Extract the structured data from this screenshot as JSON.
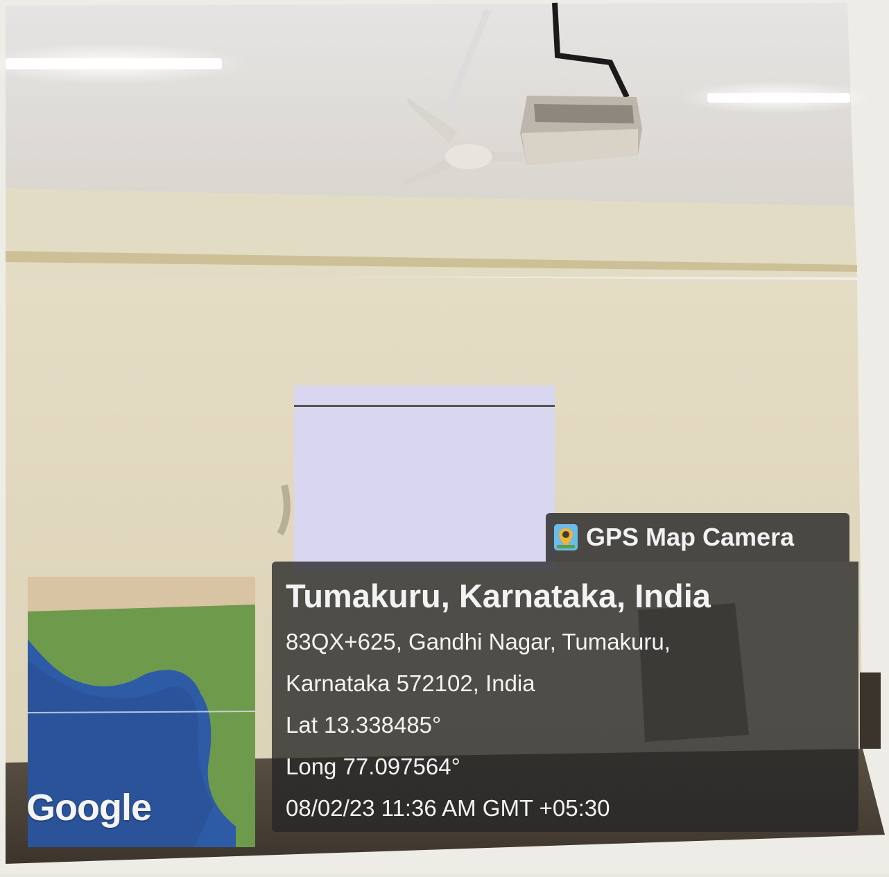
{
  "overlay": {
    "app_name": "GPS Map Camera",
    "map_logo_text": "Google",
    "location_title": "Tumakuru, Karnataka, India",
    "address_line_1": "83QX+625, Gandhi Nagar, Tumakuru,",
    "address_line_2": "Karnataka 572102, India",
    "latitude": "Lat 13.338485°",
    "longitude": "Long 77.097564°",
    "datetime": "08/02/23 11:36 AM GMT +05:30"
  },
  "icons": {
    "app": "map-pin-camera-icon"
  }
}
